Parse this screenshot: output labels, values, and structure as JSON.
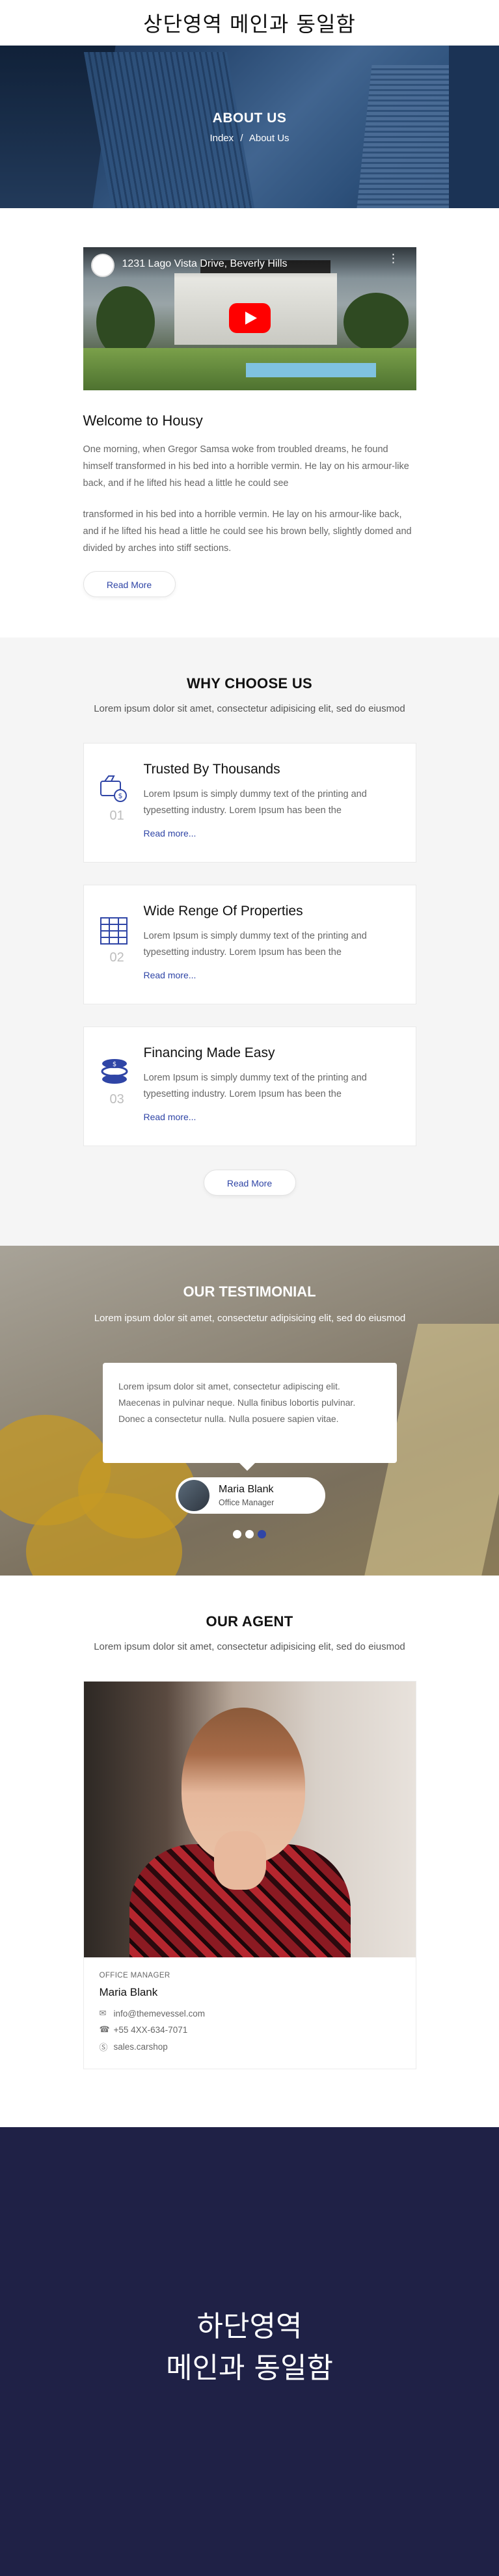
{
  "header": {
    "title": "상단영역 메인과 동일함"
  },
  "hero": {
    "title": "ABOUT US",
    "breadcrumb": {
      "home": "Index",
      "separator": "/",
      "current": "About Us"
    }
  },
  "about": {
    "video": {
      "title": "1231 Lago Vista Drive, Beverly Hills"
    },
    "heading": "Welcome to Housy",
    "paragraphs": [
      "One morning, when Gregor Samsa woke from troubled dreams, he found himself transformed in his bed into a horrible vermin. He lay on his armour-like back, and if he lifted his head a little he could see",
      "transformed in his bed into a horrible vermin. He lay on his armour-like back, and if he lifted his head a little he could see his brown belly, slightly domed and divided by arches into stiff sections."
    ],
    "button": "Read More"
  },
  "why": {
    "title": "WHY CHOOSE US",
    "subtitle": "Lorem ipsum dolor sit amet, consectetur adipisicing elit, sed do eiusmod",
    "features": [
      {
        "icon": "money-bag-icon",
        "number": "01",
        "title": "Trusted By Thousands",
        "description": "Lorem Ipsum is simply dummy text of the printing and typesetting industry. Lorem Ipsum has been the",
        "link": "Read more..."
      },
      {
        "icon": "building-icon",
        "number": "02",
        "title": "Wide Renge Of Properties",
        "description": "Lorem Ipsum is simply dummy text of the printing and typesetting industry. Lorem Ipsum has been the",
        "link": "Read more..."
      },
      {
        "icon": "coins-icon",
        "number": "03",
        "title": "Financing Made Easy",
        "description": "Lorem Ipsum is simply dummy text of the printing and typesetting industry. Lorem Ipsum has been the",
        "link": "Read more..."
      }
    ],
    "button": "Read More"
  },
  "testimonial": {
    "title": "OUR TESTIMONIAL",
    "subtitle": "Lorem ipsum dolor sit amet, consectetur adipisicing elit, sed do eiusmod",
    "quote": "Lorem ipsum dolor sit amet, consectetur adipiscing elit. Maecenas in pulvinar neque. Nulla finibus lobortis pulvinar. Donec a consectetur nulla. Nulla posuere sapien vitae.",
    "author": {
      "name": "Maria Blank",
      "role": "Office Manager"
    },
    "slides": 3,
    "active_slide": 3
  },
  "agent": {
    "title": "OUR AGENT",
    "subtitle": "Lorem ipsum dolor sit amet, consectetur adipisicing elit, sed do eiusmod",
    "role": "OFFICE MANAGER",
    "name": "Maria Blank",
    "email": "info@themevessel.com",
    "phone": "+55 4XX-634-7071",
    "skype": "sales.carshop"
  },
  "footer": {
    "line1": "하단영역",
    "line2": "메인과 동일함"
  },
  "colors": {
    "accent": "#2f45a6",
    "footer_bg": "#1f2146",
    "section_bg": "#f5f5f5"
  }
}
